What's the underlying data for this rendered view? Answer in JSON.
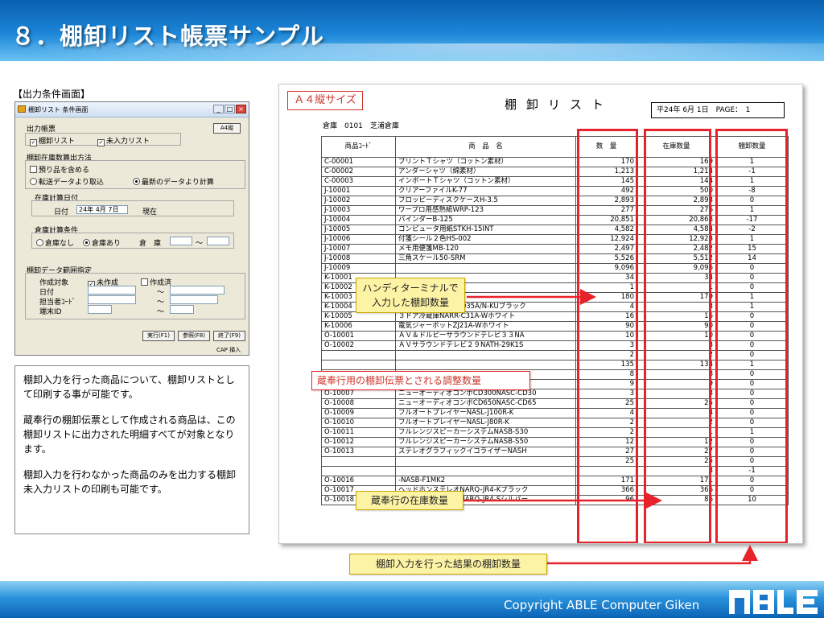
{
  "slide": {
    "title": "８．棚卸リスト帳票サンプル",
    "copyright": "Copyright ABLE Computer Giken",
    "section_label": "【出力条件画面】"
  },
  "dialog": {
    "title": "棚卸リスト 条件画面",
    "output_form_label": "出力帳票",
    "paper": "A4縦",
    "chk_inventory_list": "棚卸リスト",
    "chk_uninput_list": "未入力リスト",
    "calc_method_label": "棚卸在庫数算出方法",
    "chk_include_deposit": "預り品を含める",
    "radio_transfer": "転送データより取込",
    "radio_latest": "最新のデータより計算",
    "stock_calc_date_label": "在庫計算日付",
    "date_label": "日付",
    "date_value": "24年 4月 7日",
    "current_label": "現在",
    "warehouse_cond_label": "倉庫計算条件",
    "radio_no_warehouse": "倉庫なし",
    "radio_with_warehouse": "倉庫あり",
    "warehouse_label": "倉　庫",
    "range_sep": "～",
    "data_range_label": "棚卸データ範囲指定",
    "target_label": "作成対象",
    "chk_uncreated": "未作成",
    "chk_created": "作成済",
    "row_date": "日付",
    "row_person": "担当者ｺｰﾄﾞ",
    "row_terminal": "端末ID",
    "btn_run": "実行(F1)",
    "btn_ref": "参照(F8)",
    "btn_end": "終了(F9)",
    "status": "CAP 挿入"
  },
  "description": {
    "p1": "棚卸入力を行った商品について、棚卸リストとして印刷する事が可能です。",
    "p2": "蔵奉行の棚卸伝票として作成される商品は、この棚卸リストに出力された明細すべてが対象となります。",
    "p3": "棚卸入力を行わなかった商品のみを出力する棚卸未入力リストの印刷も可能です。"
  },
  "report": {
    "size_label": "Ａ４縦サイズ",
    "title": "棚卸リスト",
    "date_page": "平24年 6月 1日　PAGE：　1",
    "warehouse": "倉庫　0101　芝浦倉庫",
    "columns": [
      "商品ｺｰﾄﾞ",
      "商　品　名",
      "数　量",
      "在庫数量",
      "棚卸数量"
    ],
    "rows": [
      [
        "C-00001",
        "プリントＴシャツ（コットン素材）",
        "170",
        "169",
        "1"
      ],
      [
        "C-00002",
        "アンダーシャツ（綿素材）",
        "1,213",
        "1,214",
        "-1"
      ],
      [
        "C-00003",
        "インポートＴシャツ（コットン素材）",
        "145",
        "144",
        "1"
      ],
      [
        "J-10001",
        "クリアーファイルK-77",
        "492",
        "500",
        "-8"
      ],
      [
        "J-10002",
        "フロッピーディスクケースH-3.5",
        "2,893",
        "2,893",
        "0"
      ],
      [
        "J-10003",
        "ワープロ用感熱紙WRP-123",
        "277",
        "276",
        "1"
      ],
      [
        "J-10004",
        "バインダーB-125",
        "20,851",
        "20,868",
        "-17"
      ],
      [
        "J-10005",
        "コンピュータ用紙STKH-15INT",
        "4,582",
        "4,584",
        "-2"
      ],
      [
        "J-10006",
        "付箋シール２色HS-002",
        "12,924",
        "12,923",
        "1"
      ],
      [
        "J-10007",
        "メモ用便箋MB-120",
        "2,497",
        "2,482",
        "15"
      ],
      [
        "J-10008",
        "三角スケール50-SRM",
        "5,526",
        "5,512",
        "14"
      ],
      [
        "J-10009",
        "",
        "9,096",
        "9,096",
        "0"
      ],
      [
        "K-10001",
        "",
        "34",
        "34",
        "0"
      ],
      [
        "K-10002",
        "",
        "1",
        "1",
        "0"
      ],
      [
        "K-10003",
        "-D32-TWレッド",
        "180",
        "179",
        "1"
      ],
      [
        "K-10004",
        "４ドア冷蔵庫NARR-D35A/N-KUブラック",
        "4",
        "3",
        "1"
      ],
      [
        "K-10005",
        "３ドア冷蔵庫NARR-C31A-Wホワイト",
        "16",
        "16",
        "0"
      ],
      [
        "K-10006",
        "電気ジャーポットZJ21A-Wホワイト",
        "90",
        "90",
        "0"
      ],
      [
        "O-10001",
        "ＡＶ＆ドルビーサラウンドテレビ３３NA",
        "10",
        "10",
        "0"
      ],
      [
        "O-10002",
        "ＡＶサラウンドテレビ２９NATH-29K1S",
        "3",
        "3",
        "0"
      ],
      [
        "",
        "",
        "2",
        "2",
        "0"
      ],
      [
        "",
        "",
        "135",
        "134",
        "1"
      ],
      [
        "",
        "",
        "8",
        "8",
        "0"
      ],
      [
        "O-10006",
        "文字放送内蔵テレビNATH-19T2",
        "9",
        "9",
        "0"
      ],
      [
        "O-10007",
        "ニューオーディオコンポCD300NASC-CD30",
        "3",
        "3",
        "0"
      ],
      [
        "O-10008",
        "ニューオーディオコンポCD650NASC-CD65",
        "25",
        "25",
        "0"
      ],
      [
        "O-10009",
        "フルオートプレイヤーNASL-J100R-K",
        "4",
        "4",
        "0"
      ],
      [
        "O-10010",
        "フルオートプレイヤーNASL-J80R-K",
        "2",
        "2",
        "0"
      ],
      [
        "O-10011",
        "フルレンジスピーカーシステムNASB-S30",
        "2",
        "1",
        "1"
      ],
      [
        "O-10012",
        "フルレンジスピーカーシステムNASB-S50",
        "12",
        "12",
        "0"
      ],
      [
        "O-10013",
        "ステレオグラフィックイコライザーNASH",
        "27",
        "27",
        "0"
      ],
      [
        "",
        "",
        "25",
        "25",
        "0"
      ],
      [
        "",
        "",
        "",
        "3",
        "-1"
      ],
      [
        "O-10016",
        "-NASB-F1MK2",
        "171",
        "171",
        "0"
      ],
      [
        "O-10017",
        "ヘッドホンステレオNARQ-JR4-Kブラック",
        "366",
        "366",
        "0"
      ],
      [
        "O-10018",
        "ヘッドホンステレオNARQ-JR4-Sシルバー",
        "96",
        "86",
        "10"
      ]
    ]
  },
  "callouts": {
    "handy": "ハンディターミナルで\n入力した棚卸数量",
    "adjust": "蔵奉行用の棚卸伝票とされる調整数量",
    "stock": "蔵奉行の在庫数量",
    "result": "棚卸入力を行った結果の棚卸数量"
  },
  "colors": {
    "accent_red": "#e8222a",
    "header_blue": "#1c86d8",
    "callout_yellow": "#fdf3a5"
  }
}
